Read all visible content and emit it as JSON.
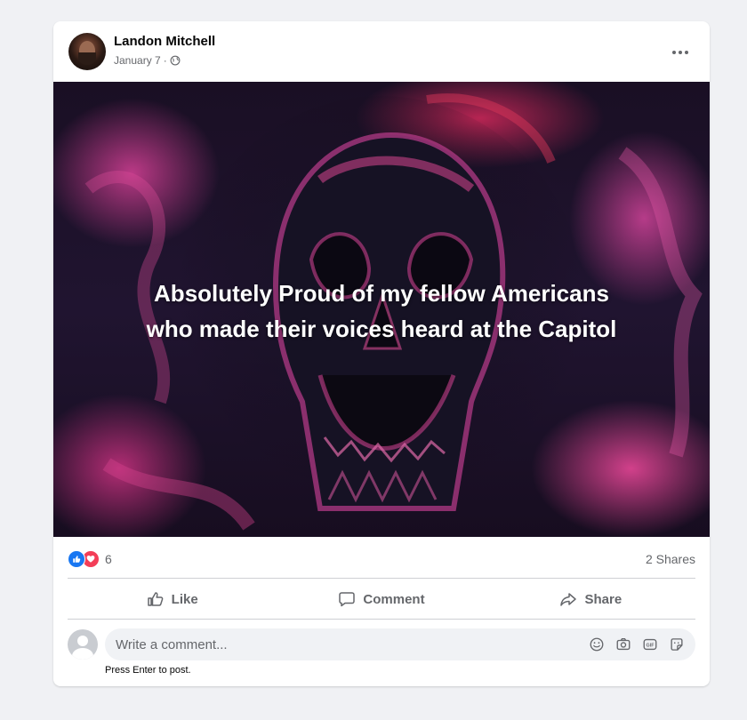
{
  "post": {
    "author": "Landon Mitchell",
    "date": "January 7",
    "separator": "·",
    "privacy_icon": "globe-icon",
    "more_icon": "more-options-icon",
    "image_caption_line1": "Absolutely Proud of my fellow Americans",
    "image_caption_line2": "who made their voices heard at the Capitol"
  },
  "reactions": {
    "icons": [
      "like-reaction-icon",
      "love-reaction-icon"
    ],
    "count": "6",
    "shares": "2 Shares"
  },
  "actions": {
    "like_label": "Like",
    "comment_label": "Comment",
    "share_label": "Share"
  },
  "comment_box": {
    "placeholder": "Write a comment...",
    "hint": "Press Enter to post.",
    "tools": [
      "emoji-icon",
      "camera-icon",
      "gif-icon",
      "sticker-icon"
    ]
  },
  "colors": {
    "like_blue": "#1877f2",
    "love_red": "#f33e58",
    "secondary_text": "#65676b",
    "card_bg": "#ffffff",
    "page_bg": "#f0f1f4"
  }
}
